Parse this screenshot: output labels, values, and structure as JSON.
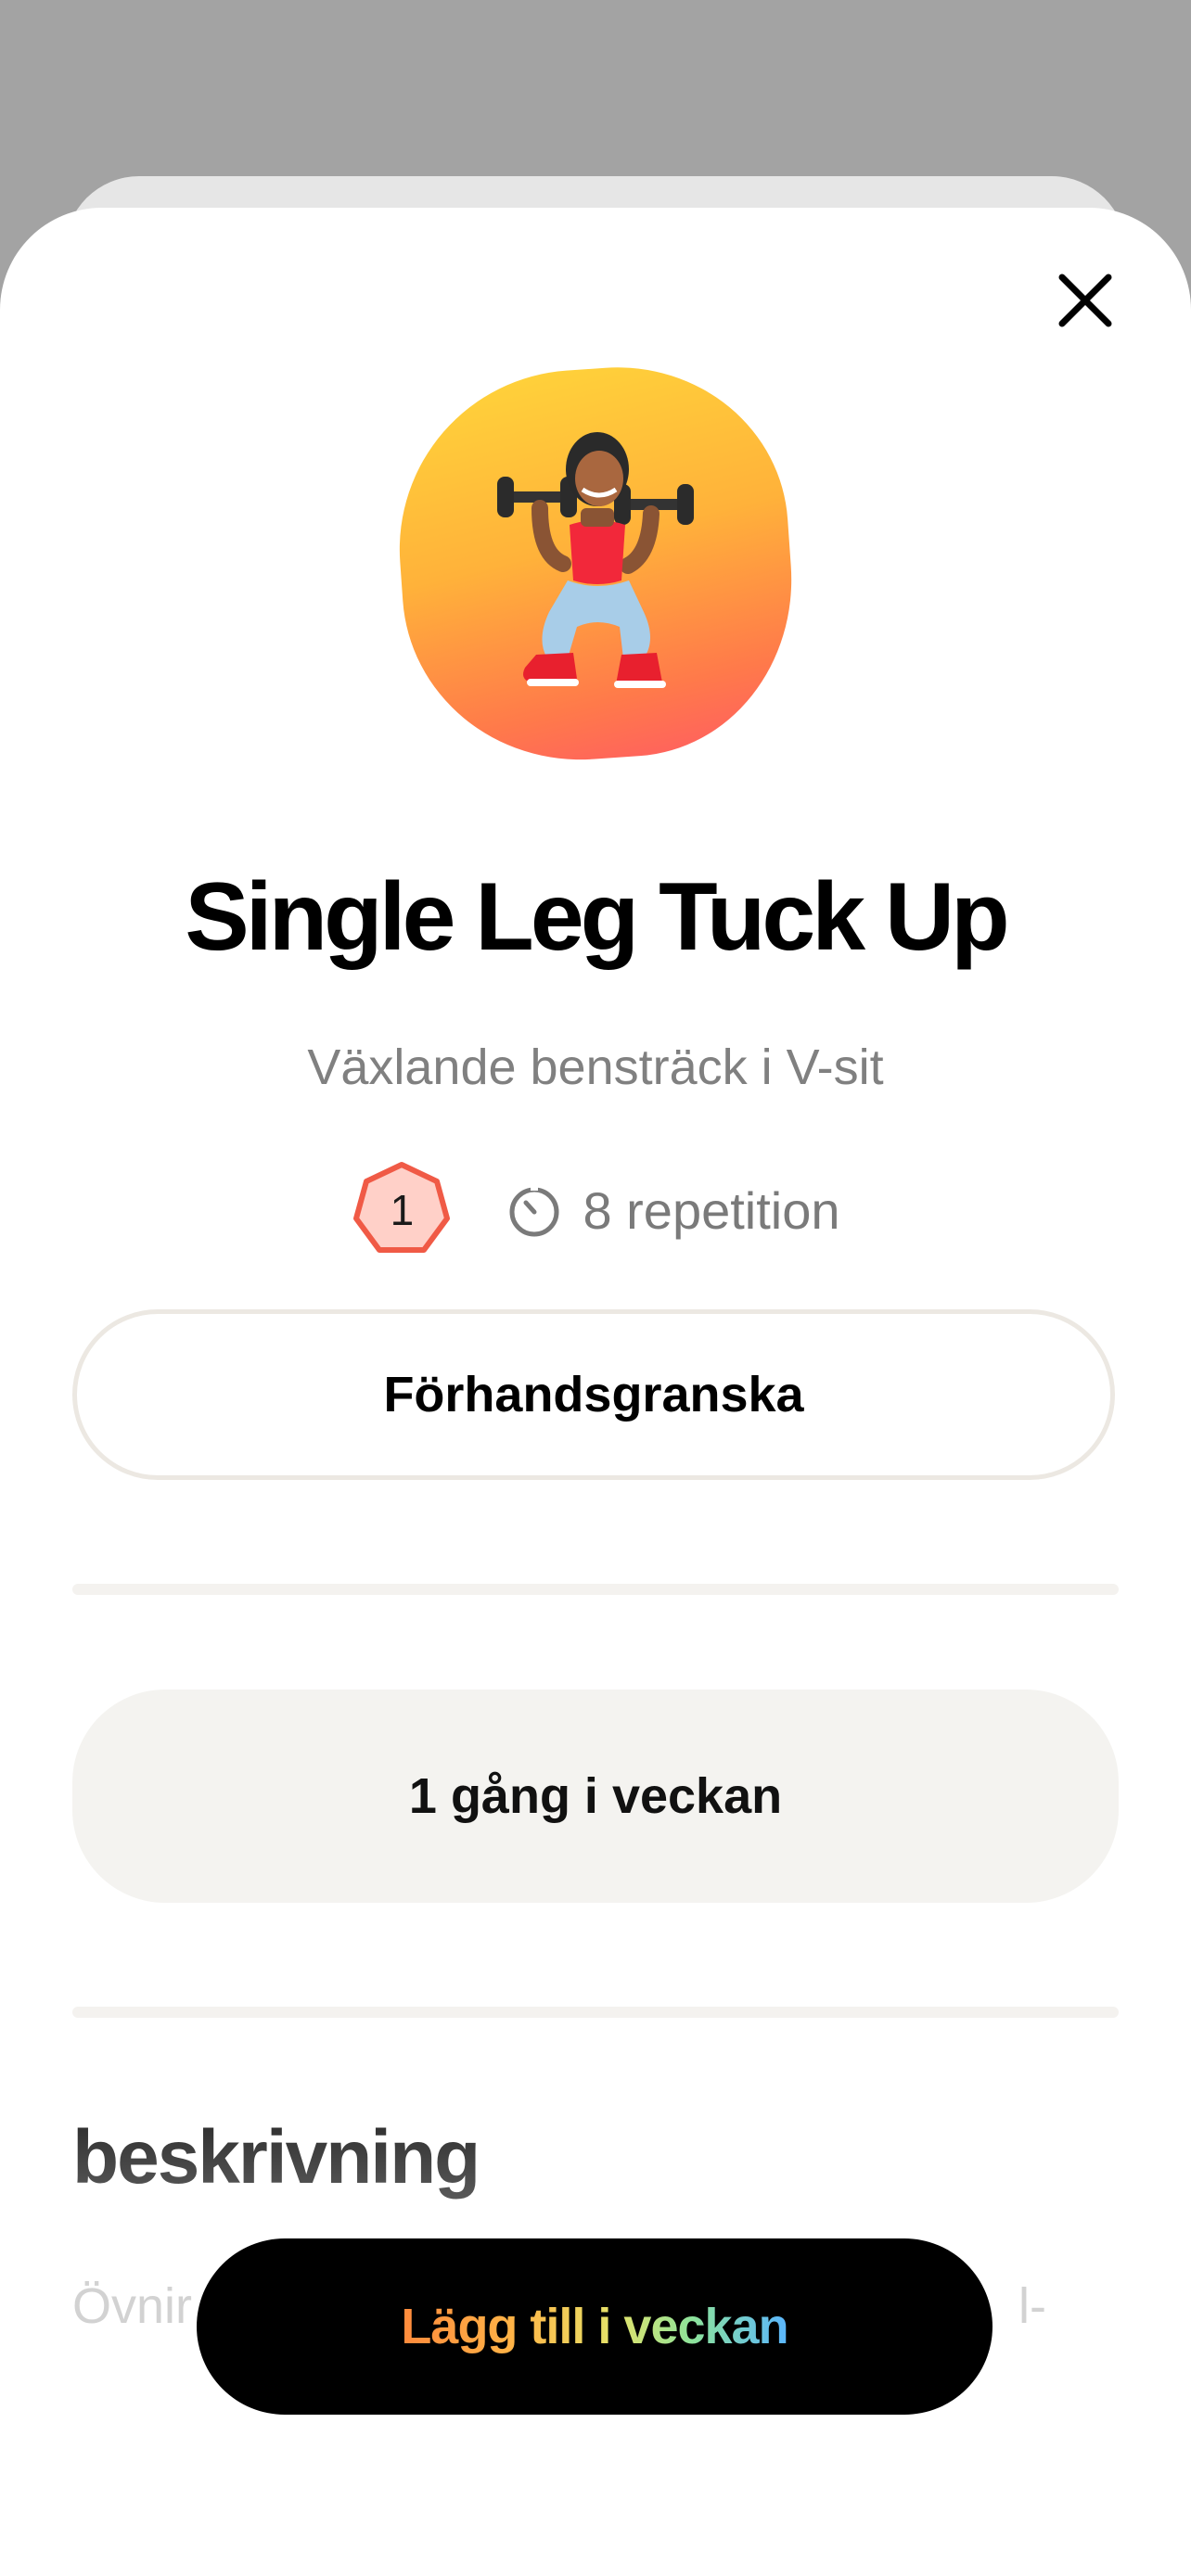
{
  "sheet": {
    "close_icon": "close-icon"
  },
  "exercise": {
    "title": "Single Leg Tuck Up",
    "subtitle": "Växlande bensträck i V-sit",
    "level": "1",
    "reps_icon": "timer-icon",
    "reps_text": "8 repetition"
  },
  "actions": {
    "preview_label": "Förhandsgranska",
    "frequency_label": "1 gång i veckan",
    "cta_label": "Lägg till i veckan"
  },
  "description": {
    "heading": "beskrivning",
    "text_visible_start": "Övnir",
    "text_visible_end": "l-"
  },
  "colors": {
    "level_badge_fill": "#ffd0c8",
    "level_badge_stroke": "#f05a46",
    "hero_top": "#ffd53a",
    "hero_bottom": "#ff5c62",
    "cta_background": "#000000"
  }
}
